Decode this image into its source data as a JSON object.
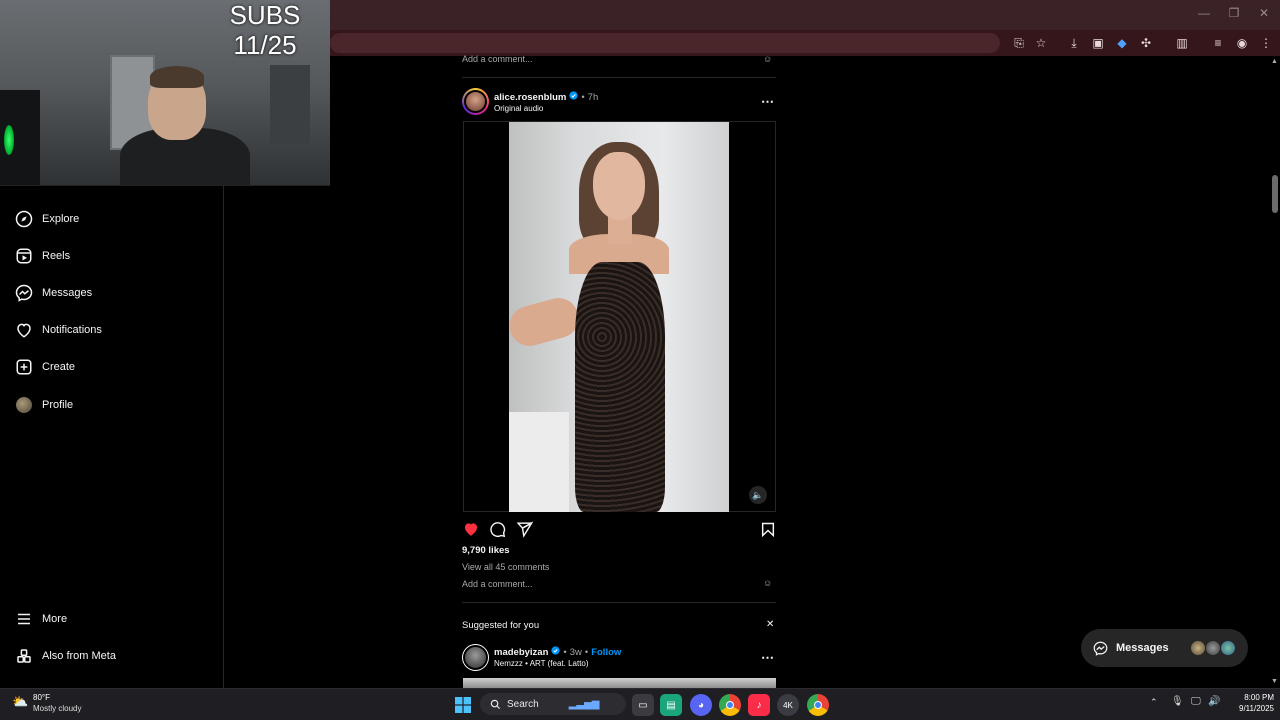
{
  "overlay": {
    "subs_line1": "SUBS",
    "subs_line2": "11/25"
  },
  "sidebar": {
    "items": [
      {
        "label": "Explore",
        "icon": "compass-icon"
      },
      {
        "label": "Reels",
        "icon": "reels-icon"
      },
      {
        "label": "Messages",
        "icon": "messenger-icon"
      },
      {
        "label": "Notifications",
        "icon": "heart-icon"
      },
      {
        "label": "Create",
        "icon": "plus-square-icon"
      },
      {
        "label": "Profile",
        "icon": "avatar"
      }
    ],
    "more_label": "More",
    "meta_label": "Also from Meta"
  },
  "feed": {
    "prev_comment_placeholder": "Add a comment...",
    "post": {
      "username": "alice.rosenblum",
      "verified": true,
      "time": "7h",
      "audio": "Original audio",
      "likes": "9,790 likes",
      "view_comments": "View all 45 comments",
      "comment_placeholder": "Add a comment...",
      "liked": true
    },
    "suggested": {
      "heading": "Suggested for you",
      "username": "madebyizan",
      "verified": true,
      "time": "3w",
      "follow_label": "Follow",
      "audio": "Nemzzz • ART (feat. Latto)"
    }
  },
  "messages_pill": {
    "label": "Messages"
  },
  "taskbar": {
    "weather_temp": "80°F",
    "weather_desc": "Mostly cloudy",
    "search_label": "Search",
    "time": "8:00 PM",
    "date": "9/11/2025"
  },
  "colors": {
    "like_red": "#ff3040",
    "follow_blue": "#0095f6",
    "browser_frame": "#35171b",
    "taskbar": "#1f1f23"
  }
}
